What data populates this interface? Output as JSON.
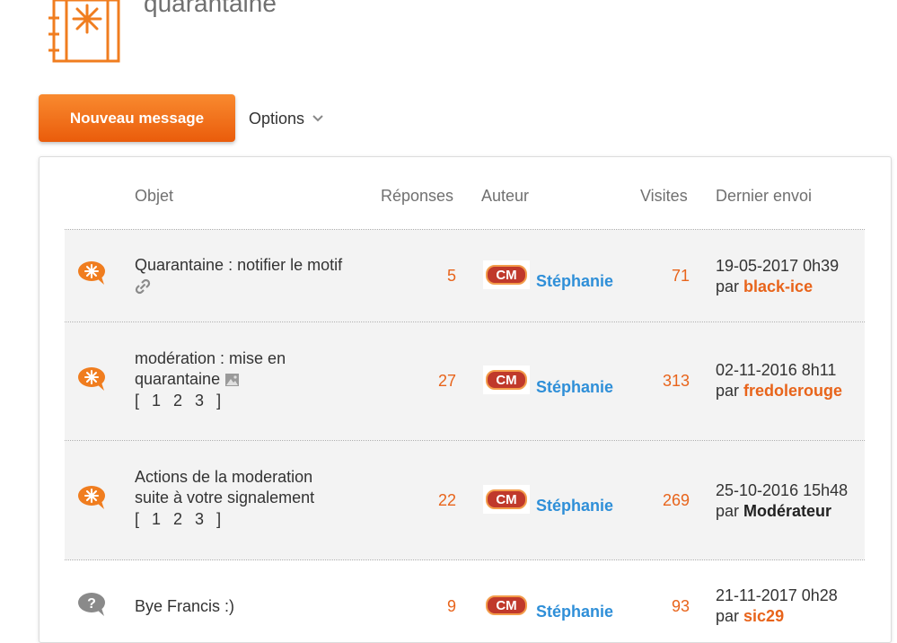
{
  "header": {
    "title": "quarantaine",
    "logo_icon": "quarantine-notebook-icon",
    "accent_color": "#f07d1f"
  },
  "toolbar": {
    "new_message_label": "Nouveau message",
    "options_label": "Options"
  },
  "table": {
    "columns": {
      "subject": "Objet",
      "replies": "Réponses",
      "author": "Auteur",
      "visits": "Visites",
      "last_post": "Dernier envoi"
    },
    "rows": [
      {
        "icon": "orange-speech-bubble-icon",
        "subject_line1": "Quarantaine : notifier le motif",
        "subject_line2": "",
        "attachment_icon": "link-icon",
        "pages": [],
        "replies": "5",
        "author_badge": "CM",
        "author": "Stéphanie",
        "visits": "71",
        "last_date": "19-05-2017 0h39",
        "last_by_prefix": "par",
        "last_user": "black-ice"
      },
      {
        "icon": "orange-speech-bubble-icon",
        "subject_line1": "modération : mise en",
        "subject_line2": "quarantaine",
        "attachment_icon": "image-icon",
        "pages": [
          "[",
          "1",
          "2",
          "3",
          "]"
        ],
        "replies": "27",
        "author_badge": "CM",
        "author": "Stéphanie",
        "visits": "313",
        "last_date": "02-11-2016 8h11",
        "last_by_prefix": "par",
        "last_user": "fredolerouge"
      },
      {
        "icon": "orange-speech-bubble-icon",
        "subject_line1": "Actions de la moderation",
        "subject_line2": "suite à votre signalement",
        "attachment_icon": "",
        "pages": [
          "[",
          "1",
          "2",
          "3",
          "]"
        ],
        "replies": "22",
        "author_badge": "CM",
        "author": "Stéphanie",
        "visits": "269",
        "last_date": "25-10-2016 15h48",
        "last_by_prefix": "par",
        "last_user": "Modérateur"
      },
      {
        "icon": "grey-question-bubble-icon",
        "subject_line1": "Bye Francis :)",
        "subject_line2": "",
        "attachment_icon": "",
        "pages": [],
        "replies": "9",
        "author_badge": "CM",
        "author": "Stéphanie",
        "visits": "93",
        "last_date": "21-11-2017 0h28",
        "last_by_prefix": "par",
        "last_user": "sic29"
      }
    ]
  }
}
